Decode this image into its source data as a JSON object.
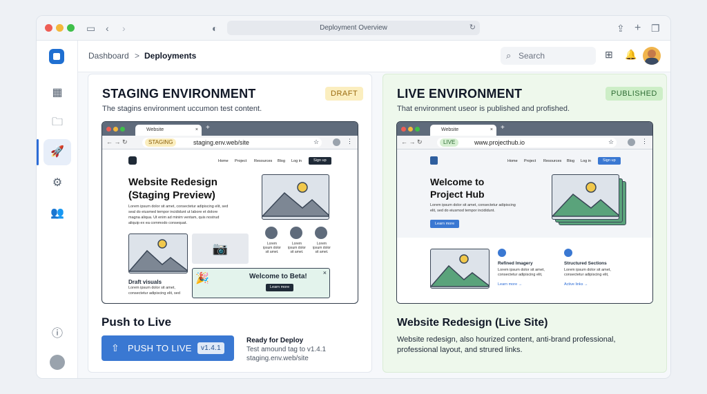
{
  "window": {
    "title": "Deployment Overview"
  },
  "breadcrumb": {
    "root": "Dashboard",
    "separator": ">",
    "current": "Deployments"
  },
  "search": {
    "placeholder": "Search"
  },
  "sidebar": {
    "items": [
      "grid-icon",
      "folder-icon",
      "rocket-icon",
      "gear-icon",
      "users-icon"
    ],
    "bottom": [
      "help-icon",
      "profile-icon"
    ]
  },
  "staging": {
    "title": "STAGING ENVIRONMENT",
    "badge": "DRAFT",
    "subtitle": "The stagins environment uccumon test content.",
    "browser": {
      "tab": "Website",
      "env": "STAGING",
      "url": "staging.env.web/site",
      "nav": [
        "Home",
        "Project",
        "Resources",
        "Blog",
        "Log in"
      ],
      "nav_button": "Sign up",
      "hero_title_1": "Website Redesign",
      "hero_title_2": "(Staging Preview)",
      "hero_text_1": "Lorem ipsum dolor sit amet, consectetur adipiscing elit, sed",
      "hero_text_2": "seal do eiusmed tempor incididunt ut labore et dolore",
      "hero_text_3": "magna aliqua. Ut enim ad minim ventam, quis nostrud",
      "hero_text_4": "aliquip ex ea commodo consequat.",
      "feat_1": "Lorem ipsum dolor sit amet.",
      "feat_2": "Lorem ipsum dolor sit amet.",
      "feat_3": "Lorem ipsum dolor sit amet.",
      "draft_label": "Draft visuals",
      "draft_text_1": "Lorem ipsum dolor sit amet,",
      "draft_text_2": "consectetur adipiscing elit, sed",
      "banner_title": "Welcome to Beta!",
      "banner_button": "Learn more"
    },
    "push": {
      "heading": "Push to Live",
      "button": "PUSH TO LIVE",
      "version": "v1.4.1",
      "info_title": "Ready for Deploy",
      "info_line_1": "Test amound tag to v1.4.1",
      "info_line_2": "staging.env.web/site"
    }
  },
  "live": {
    "title": "LIVE ENVIRONMENT",
    "badge": "PUBLISHED",
    "subtitle": "That environment useor is published and profished.",
    "browser": {
      "tab": "Website",
      "env": "LIVE",
      "url": "www.projecthub.io",
      "nav": [
        "Home",
        "Project",
        "Resources",
        "Blog",
        "Log in"
      ],
      "nav_button": "Sign up",
      "hero_title_1": "Welcome to",
      "hero_title_2": "Project Hub",
      "hero_text_1": "Lorem ipsum dolor sit amet, consectetur adipiscing",
      "hero_text_2": "elit, sed do eiusmod tempor incididunt.",
      "hero_button": "Learn more",
      "feat_1_title": "Refined Imagery",
      "feat_1_text_1": "Lorem ipsum dolor sit amet,",
      "feat_1_text_2": "consectetur adipiscing elit,",
      "feat_1_link": "Learn more →",
      "feat_2_title": "Structured Sections",
      "feat_2_text_1": "Lorem ipsum dolor sit amet,",
      "feat_2_text_2": "consectetur adipiscing elit,",
      "feat_2_link": "Active links →"
    },
    "section_title": "Website Redesign (Live Site)",
    "description": "Website redesign, also hourized content, anti-brand professional, professional layout, and strured links."
  },
  "colors": {
    "accent": "#3a78d2",
    "draft": "#f6e7b5",
    "published": "#cdeec7",
    "live_green": "#5aa37b"
  }
}
